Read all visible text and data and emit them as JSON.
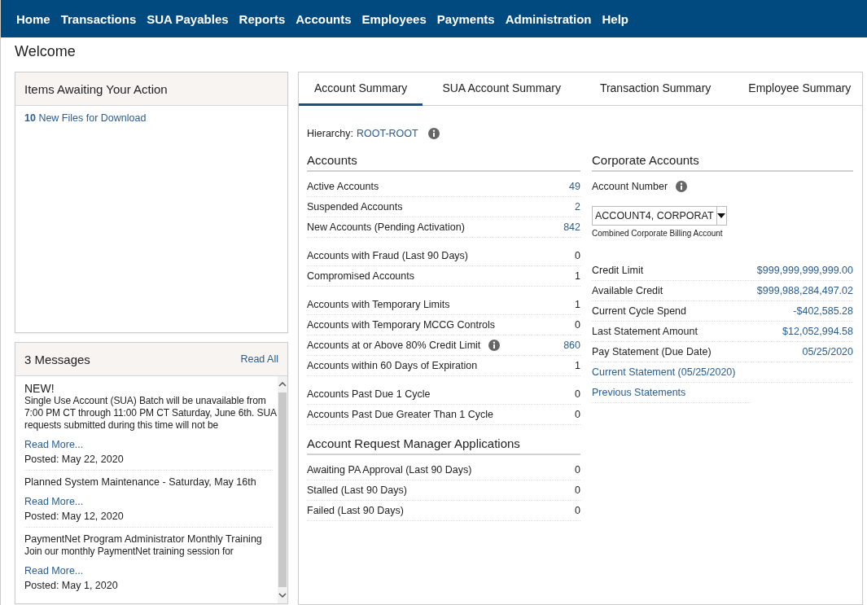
{
  "nav": [
    "Home",
    "Transactions",
    "SUA Payables",
    "Reports",
    "Accounts",
    "Employees",
    "Payments",
    "Administration",
    "Help"
  ],
  "page_title": "Welcome",
  "action_panel": {
    "title": "Items Awaiting Your Action",
    "items": [
      {
        "count": "10",
        "label": "New Files for Download"
      }
    ]
  },
  "messages_panel": {
    "title": "3 Messages",
    "read_all": "Read All",
    "messages": [
      {
        "headline": "NEW!",
        "body": "Single Use Account (SUA) Batch will be unavailable from 7:00 PM CT through 11:00 PM CT Saturday, June 6th. SUA requests submitted during this time will not be",
        "read_more": "Read More...",
        "posted": "Posted:  May 22, 2020"
      },
      {
        "headline": "Planned System Maintenance - Saturday, May 16th",
        "read_more": "Read More...",
        "posted": "Posted:  May 12, 2020"
      },
      {
        "headline": "PaymentNet Program Administrator Monthly Training",
        "body": "Join our monthly PaymentNet training session for",
        "read_more": "Read More...",
        "posted": "Posted:  May 1, 2020"
      }
    ]
  },
  "tabs": [
    {
      "label": "Account Summary",
      "selected": true
    },
    {
      "label": "SUA Account Summary",
      "selected": false
    },
    {
      "label": "Transaction Summary",
      "selected": false
    },
    {
      "label": "Employee Summary",
      "selected": false
    }
  ],
  "hierarchy": {
    "label": "Hierarchy:",
    "value": "ROOT-ROOT"
  },
  "accounts": {
    "title": "Accounts",
    "groups": [
      [
        {
          "label": "Active Accounts",
          "value": "49",
          "link": true,
          "info": false
        },
        {
          "label": "Suspended Accounts",
          "value": "2",
          "link": true,
          "info": false
        },
        {
          "label": "New Accounts (Pending Activation)",
          "value": "842",
          "link": true,
          "info": false
        }
      ],
      [
        {
          "label": "Accounts with Fraud (Last 90 Days)",
          "value": "0",
          "link": false,
          "info": false
        },
        {
          "label": "Compromised Accounts",
          "value": "1",
          "link": false,
          "info": false
        }
      ],
      [
        {
          "label": "Accounts with Temporary Limits",
          "value": "1",
          "link": false,
          "info": false
        },
        {
          "label": "Accounts with Temporary MCCG Controls",
          "value": "0",
          "link": false,
          "info": false
        },
        {
          "label": "Accounts at or Above 80% Credit Limit",
          "value": "860",
          "link": true,
          "info": true
        },
        {
          "label": "Accounts within 60 Days of Expiration",
          "value": "1",
          "link": false,
          "info": false
        }
      ],
      [
        {
          "label": "Accounts Past Due 1 Cycle",
          "value": "0",
          "link": false,
          "info": false
        },
        {
          "label": "Accounts Past Due Greater Than 1 Cycle",
          "value": "0",
          "link": false,
          "info": false
        }
      ]
    ]
  },
  "applications": {
    "title": "Account Request Manager Applications",
    "rows": [
      {
        "label": "Awaiting PA Approval (Last 90 Days)",
        "value": "0"
      },
      {
        "label": "Stalled (Last 90 Days)",
        "value": "0"
      },
      {
        "label": "Failed (Last 90 Days)",
        "value": "0"
      }
    ]
  },
  "corporate": {
    "title": "Corporate Accounts",
    "account_number_label": "Account Number",
    "account_select": "ACCOUNT4, CORPORAT",
    "select_caption": "Combined Corporate Billing Account",
    "rows": [
      {
        "kind": "stat",
        "label": "Credit Limit",
        "value": "$999,999,999,999.00"
      },
      {
        "kind": "stat",
        "label": "Available Credit",
        "value": "$999,988,284,497.02"
      },
      {
        "kind": "stat",
        "label": "Current Cycle Spend",
        "value": "-$402,585.28"
      },
      {
        "kind": "stat",
        "label": "Last Statement Amount",
        "value": "$12,052,994.58"
      },
      {
        "kind": "stat",
        "label": "Pay Statement (Due Date)",
        "value": "05/25/2020"
      },
      {
        "kind": "link",
        "label": "Current Statement (05/25/2020)"
      },
      {
        "kind": "link",
        "label": "Previous Statements"
      }
    ]
  }
}
